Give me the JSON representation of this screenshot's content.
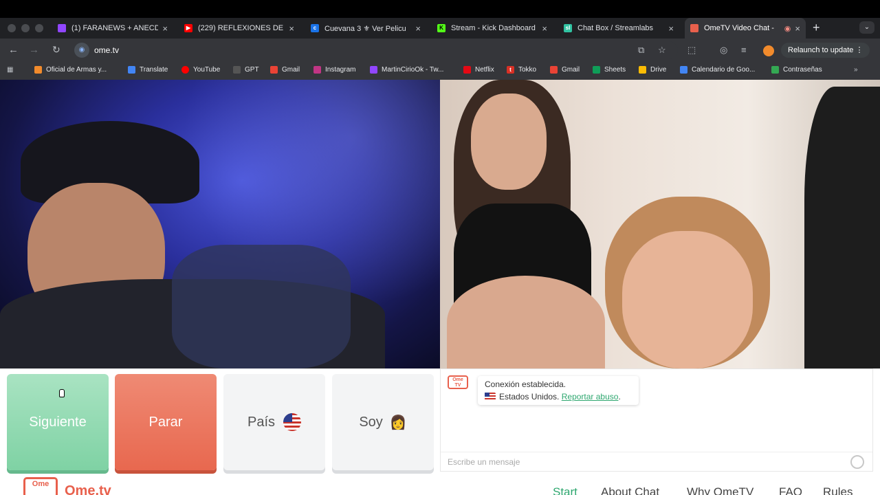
{
  "tabs": [
    {
      "title": "(1) FARANEWS + ANECD",
      "color": "#9146ff",
      "glyph": ""
    },
    {
      "title": "(229) REFLEXIONES DE",
      "color": "#ff0000",
      "glyph": "▶"
    },
    {
      "title": "Cuevana 3 ⚜ Ver Pelicu",
      "color": "#1a73e8",
      "glyph": "c"
    },
    {
      "title": "Stream - Kick Dashboard",
      "color": "#53fc18",
      "glyph": "K"
    },
    {
      "title": "Chat Box / Streamlabs",
      "color": "#31c3a2",
      "glyph": "sl"
    },
    {
      "title": "OmeTV Video Chat -",
      "color": "#e8604c",
      "glyph": ""
    }
  ],
  "address": {
    "url": "ome.tv"
  },
  "toolbar": {
    "relaunch_label": "Relaunch to update"
  },
  "bookmarks": [
    {
      "label": "Oficial de Armas y...",
      "color": "#f28b2c"
    },
    {
      "label": "Translate",
      "color": "#4285f4"
    },
    {
      "label": "YouTube",
      "color": "#ff0000"
    },
    {
      "label": "GPT",
      "color": "#555555"
    },
    {
      "label": "Gmail",
      "color": "#ea4335"
    },
    {
      "label": "Instagram",
      "color": "#c13584"
    },
    {
      "label": "MartinCirioOk - Tw...",
      "color": "#9146ff"
    },
    {
      "label": "Netflix",
      "color": "#e50914"
    },
    {
      "label": "Tokko",
      "color": "#d93025"
    },
    {
      "label": "Gmail",
      "color": "#ea4335"
    },
    {
      "label": "Sheets",
      "color": "#0f9d58"
    },
    {
      "label": "Drive",
      "color": "#fbbc04"
    },
    {
      "label": "Calendario de Goo...",
      "color": "#4285f4"
    },
    {
      "label": "Contraseñas",
      "color": "#34a853"
    }
  ],
  "controls": {
    "next_label": "Siguiente",
    "stop_label": "Parar",
    "country_label": "País",
    "gender_label": "Soy",
    "gender_emoji": "👩"
  },
  "chat": {
    "icon_text": "Ome TV",
    "connected_text": "Conexión establecida.",
    "country_text": "Estados Unidos.",
    "report_link": "Reportar abuso",
    "input_placeholder": "Escribe un mensaje"
  },
  "footer": {
    "logo_text": "Ome",
    "brand": "Ome.tv",
    "nav": [
      "Start",
      "About Chat",
      "Why OmeTV",
      "FAQ",
      "Rules"
    ]
  }
}
